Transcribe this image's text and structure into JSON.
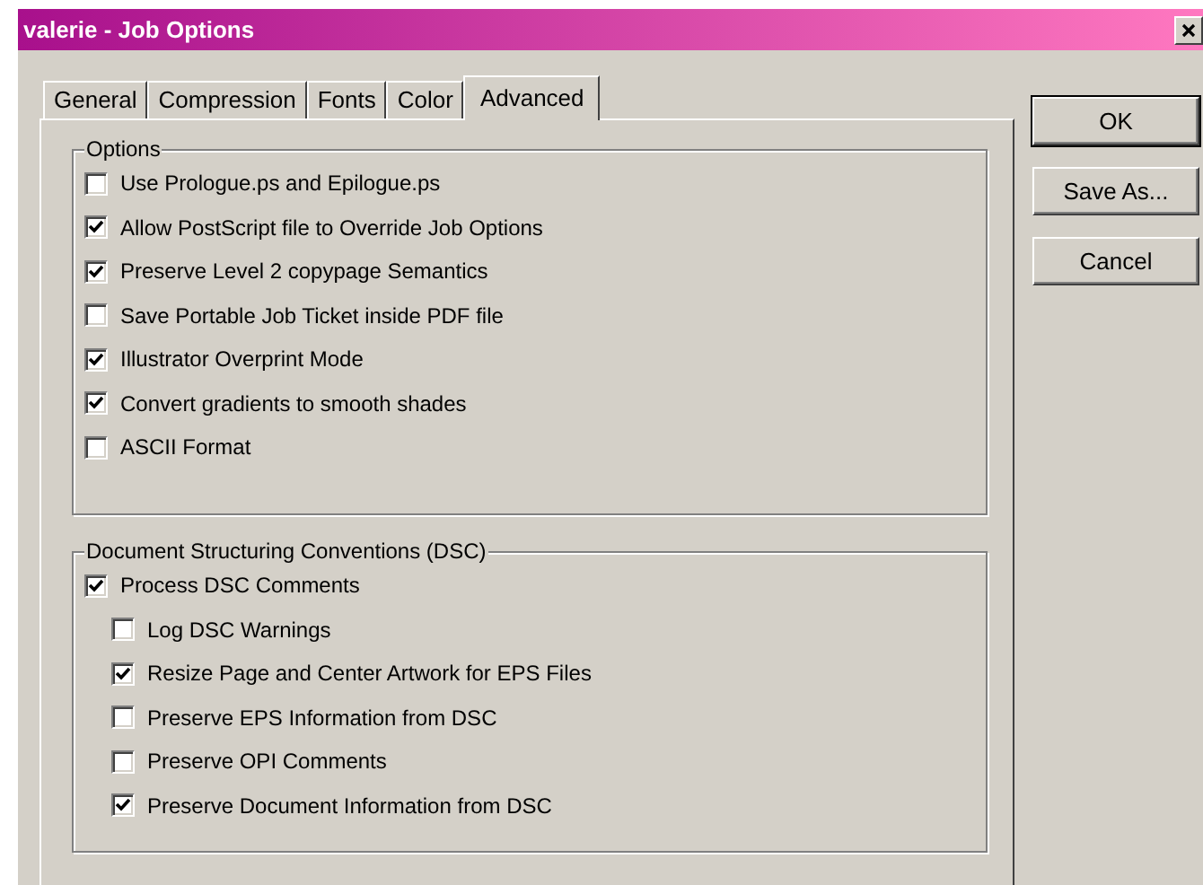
{
  "window": {
    "title": "valerie - Job Options"
  },
  "tabs": [
    {
      "label": "General",
      "selected": false
    },
    {
      "label": "Compression",
      "selected": false
    },
    {
      "label": "Fonts",
      "selected": false
    },
    {
      "label": "Color",
      "selected": false
    },
    {
      "label": "Advanced",
      "selected": true
    }
  ],
  "groups": [
    {
      "title": "Options",
      "items": [
        {
          "label": "Use Prologue.ps and Epilogue.ps",
          "checked": false
        },
        {
          "label": "Allow PostScript file to Override Job Options",
          "checked": true
        },
        {
          "label": "Preserve Level 2 copypage Semantics",
          "checked": true
        },
        {
          "label": "Save Portable Job Ticket inside PDF file",
          "checked": false
        },
        {
          "label": "Illustrator Overprint Mode",
          "checked": true
        },
        {
          "label": "Convert gradients to smooth shades",
          "checked": true
        },
        {
          "label": "ASCII Format",
          "checked": false
        }
      ]
    },
    {
      "title": "Document Structuring Conventions (DSC)",
      "items": [
        {
          "label": "Process DSC Comments",
          "checked": true,
          "children": [
            {
              "label": "Log DSC Warnings",
              "checked": false
            },
            {
              "label": "Resize Page and Center Artwork for EPS Files",
              "checked": true
            },
            {
              "label": "Preserve EPS Information from DSC",
              "checked": false
            },
            {
              "label": "Preserve OPI Comments",
              "checked": false
            },
            {
              "label": "Preserve Document Information from DSC",
              "checked": true
            }
          ]
        }
      ]
    }
  ],
  "buttons": [
    {
      "label": "OK",
      "default": true
    },
    {
      "label": "Save As...",
      "default": false
    },
    {
      "label": "Cancel",
      "default": false
    }
  ]
}
